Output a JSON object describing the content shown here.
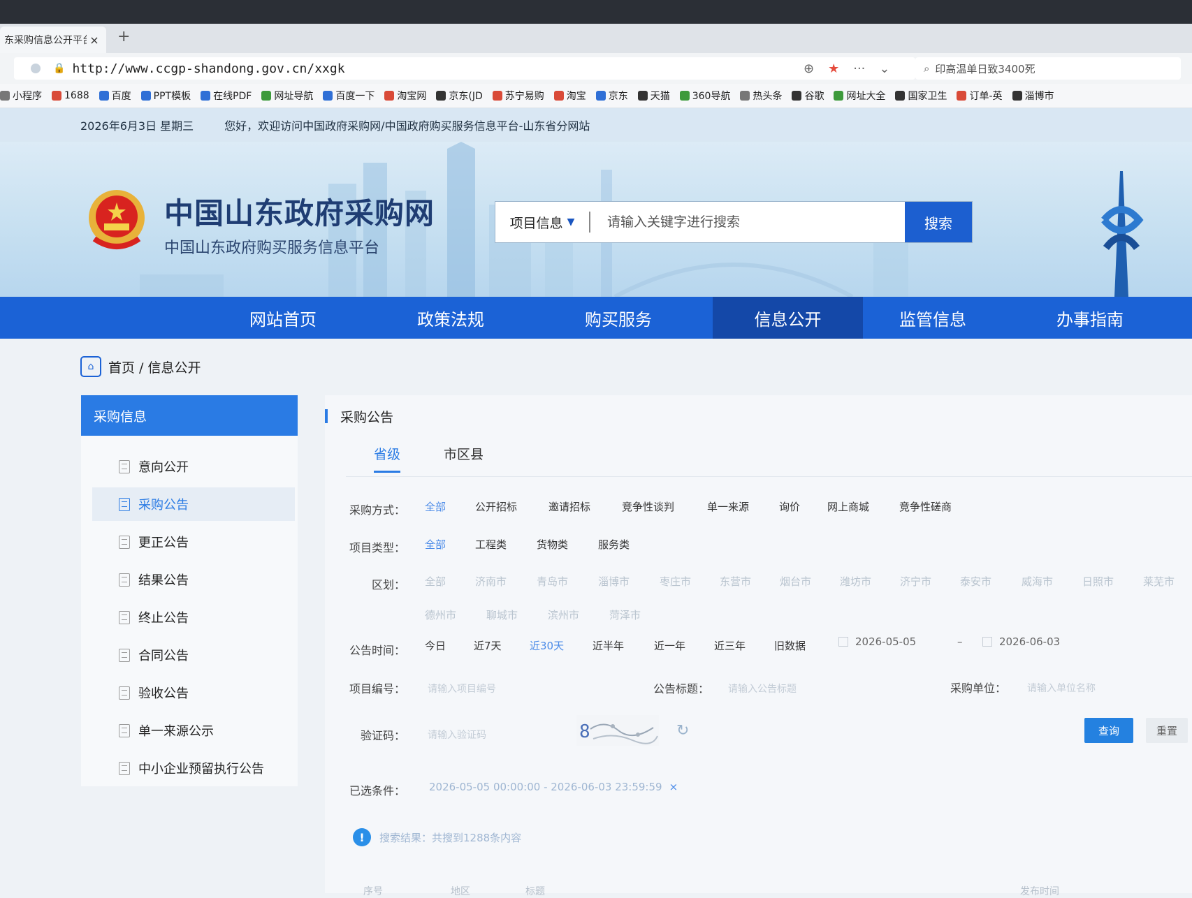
{
  "browser": {
    "tab_title": "东采购信息公开平台",
    "tab_close": "×",
    "new_tab": "+",
    "url": "http://www.ccgp-shandong.gov.cn/xxgk",
    "side_search": "印高温单日致3400死",
    "bookmarks": [
      "小程序",
      "1688",
      "百度",
      "PPT模板",
      "在线PDF",
      "网址导航",
      "百度一下",
      "淘宝网",
      "京东(JD",
      "苏宁易购",
      "淘宝",
      "京东",
      "天猫",
      "360导航",
      "热头条",
      "谷歌",
      "网址大全",
      "国家卫生",
      "订单-英",
      "淄博市"
    ]
  },
  "topinfo": {
    "date": "2026年6月3日 星期三",
    "welcome": "您好，欢迎访问中国政府采购网/中国政府购买服务信息平台-山东省分网站"
  },
  "header": {
    "title": "中国山东政府采购网",
    "subtitle": "中国山东政府购买服务信息平台",
    "search_category": "项目信息",
    "search_placeholder": "请输入关键字进行搜索",
    "search_button": "搜索"
  },
  "nav": [
    "网站首页",
    "政策法规",
    "购买服务",
    "信息公开",
    "监管信息",
    "办事指南"
  ],
  "nav_active": "信息公开",
  "breadcrumb": "首页 / 信息公开",
  "sidebar": {
    "heading": "采购信息",
    "items": [
      "意向公开",
      "采购公告",
      "更正公告",
      "结果公告",
      "终止公告",
      "合同公告",
      "验收公告",
      "单一来源公示",
      "中小企业预留执行公告"
    ],
    "active": "采购公告"
  },
  "panel": {
    "title": "采购公告",
    "tabs": [
      "省级",
      "市区县"
    ],
    "filters": {
      "method_label": "采购方式：",
      "methods": [
        "全部",
        "公开招标",
        "邀请招标",
        "竞争性谈判",
        "单一来源",
        "询价",
        "网上商城",
        "竞争性磋商"
      ],
      "type_label": "项目类型：",
      "types": [
        "全部",
        "工程类",
        "货物类",
        "服务类"
      ],
      "region_label": "区划：",
      "regions_row1": [
        "全部",
        "济南市",
        "青岛市",
        "淄博市",
        "枣庄市",
        "东营市",
        "烟台市",
        "潍坊市",
        "济宁市",
        "泰安市",
        "威海市",
        "日照市",
        "莱芜市"
      ],
      "regions_row2": [
        "德州市",
        "聊城市",
        "滨州市",
        "菏泽市"
      ],
      "time_label": "公告时间：",
      "times": [
        "今日",
        "近7天",
        "近30天",
        "近半年",
        "近一年",
        "近三年",
        "旧数据"
      ],
      "date_from": "2026-05-05",
      "date_sep": "–",
      "date_to": "2026-06-03",
      "project_no_label": "项目编号：",
      "project_no_placeholder": "请输入项目编号",
      "notice_title_label": "公告标题：",
      "notice_title_placeholder": "请输入公告标题",
      "buyer_label": "采购单位：",
      "buyer_placeholder": "请输入单位名称",
      "captcha_label": "验证码：",
      "captcha_placeholder": "请输入验证码",
      "query_button": "查询",
      "reset_button": "重置",
      "selected_label": "已选条件：",
      "selected_value": "2026-05-05 00:00:00 - 2026-06-03 23:59:59",
      "selected_clear": "×",
      "result_text": "搜索结果：共搜到1288条内容"
    },
    "table_headers": [
      "序号",
      "地区",
      "标题",
      "发布时间"
    ]
  }
}
